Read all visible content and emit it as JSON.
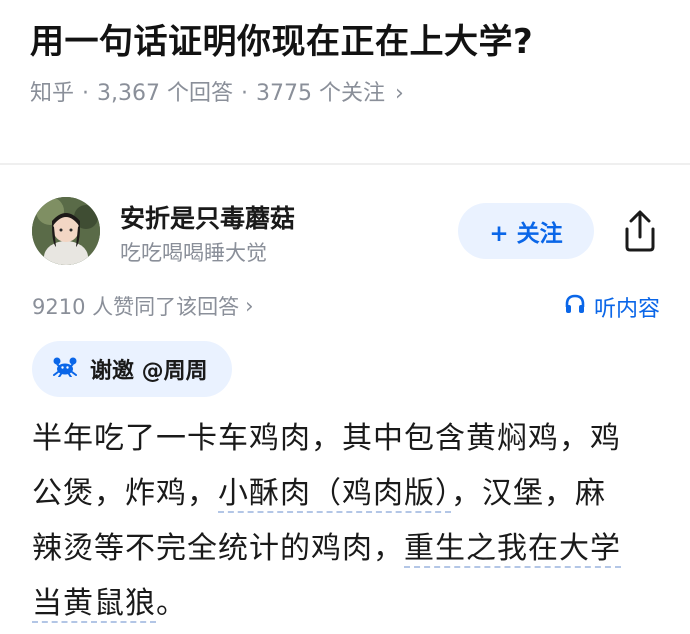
{
  "question": {
    "title": "用一句话证明你现在正在上大学?",
    "source": "知乎",
    "answers": "3,367 个回答",
    "followers": "3775 个关注",
    "chevron": "›"
  },
  "author": {
    "name": "安折是只毒蘑菇",
    "bio": "吃吃喝喝睡大觉",
    "follow_label": "+ 关注"
  },
  "answer_meta": {
    "votes": "9210 人赞同了该回答",
    "chevron": "›",
    "listen_label": "听内容"
  },
  "invite": {
    "label": "谢邀 @周周"
  },
  "content": {
    "line1": "半年吃了一卡车鸡肉，其中包含黄焖鸡，鸡",
    "line2_a": "公煲，炸鸡，",
    "line2_link": "小酥肉（鸡肉版）",
    "line2_b": "，汉堡，麻",
    "line3_a": "辣烫等不完全统计的鸡肉，",
    "line3_link": "重生之我在大学",
    "line4_link": "当黄鼠狼",
    "line4_b": "。"
  },
  "colors": {
    "accent": "#0a66e8",
    "button_bg": "#eaf2ff",
    "meta_text": "#8a8f99"
  },
  "icons": [
    "share-icon",
    "headphones-icon",
    "crab-icon",
    "chevron-right-icon"
  ]
}
